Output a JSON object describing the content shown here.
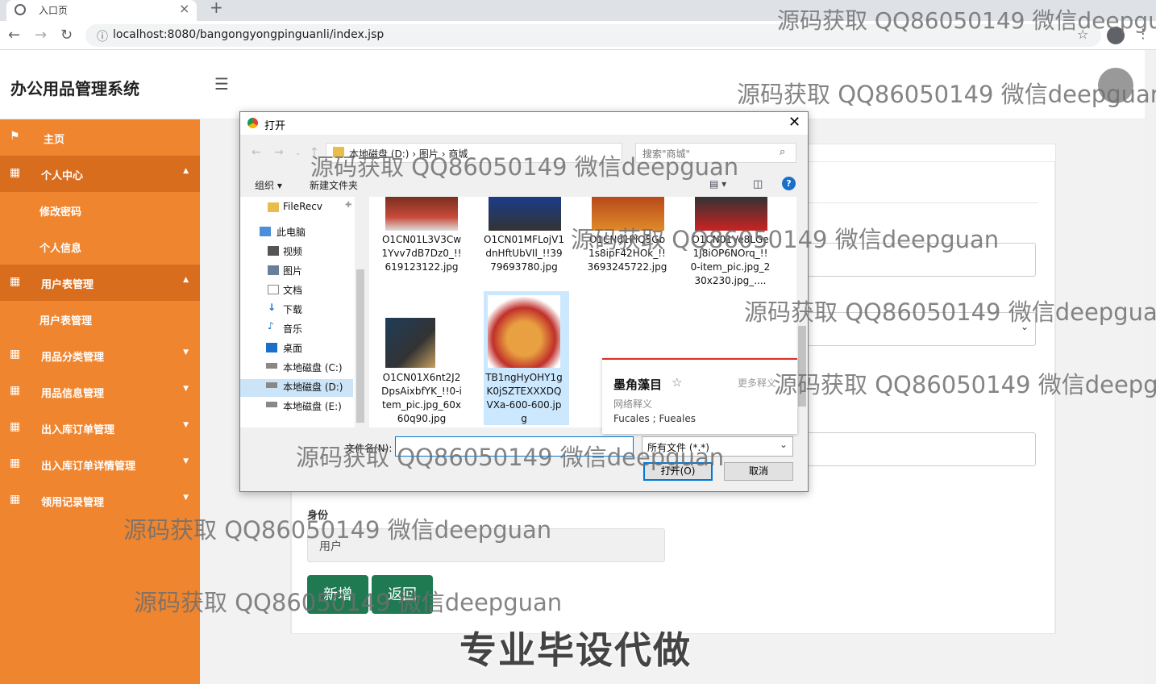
{
  "browser": {
    "tab_title": "入口页",
    "url": "localhost:8080/bangongyongpinguanli/index.jsp"
  },
  "app": {
    "title": "办公用品管理系统"
  },
  "sidebar": {
    "items": [
      {
        "label": "主页"
      },
      {
        "label": "个人中心"
      },
      {
        "label": "修改密码"
      },
      {
        "label": "个人信息"
      },
      {
        "label": "用户表管理"
      },
      {
        "label": "用户表管理"
      },
      {
        "label": "用品分类管理"
      },
      {
        "label": "用品信息管理"
      },
      {
        "label": "出入库订单管理"
      },
      {
        "label": "出入库订单详情管理"
      },
      {
        "label": "领用记录管理"
      }
    ]
  },
  "form": {
    "role_label": "身份",
    "role_value": "用户",
    "add_button": "新增",
    "back_button": "返回"
  },
  "dialog": {
    "title": "打开",
    "path": "本地磁盘 (D:)  ›  图片  ›  商城",
    "search_placeholder": "搜索\"商城\"",
    "organize": "组织 ▾",
    "new_folder": "新建文件夹",
    "nav_items": [
      "FileRecv",
      "此电脑",
      "视频",
      "图片",
      "文档",
      "下载",
      "音乐",
      "桌面",
      "本地磁盘 (C:)",
      "本地磁盘 (D:)",
      "本地磁盘 (E:)"
    ],
    "files": [
      {
        "name": "O1CN01L3V3Cw1Yvv7dB7Dz0_!!619123122.jpg"
      },
      {
        "name": "O1CN01MFLojV1dnHftUbVIl_!!3979693780.jpg"
      },
      {
        "name": "O1CN01PlQ5Gb1s8ipF42HOk_!!3693245722.jpg"
      },
      {
        "name": "O1CN01Ve8LGe1J8iOP6NOrq_!!0-item_pic.jpg_230x230.jpg_...."
      },
      {
        "name": "O1CN01X6nt2J2DpsAixbfYK_!!0-item_pic.jpg_60x60q90.jpg"
      },
      {
        "name": "TB1ngHyOHY1gK0jSZTEXXXDQVXa-600-600.jpg"
      }
    ],
    "filename_label": "文件名(N):",
    "filetype": "所有文件 (*.*)",
    "open_button": "打开(O)",
    "cancel_button": "取消"
  },
  "popup": {
    "word": "墨角藻目",
    "more": "更多释义",
    "type": "网络释义",
    "definition": "Fucales ; Fueales"
  },
  "watermark": "源码获取 QQ86050149 微信deepguan",
  "promo": "专业毕设代做"
}
